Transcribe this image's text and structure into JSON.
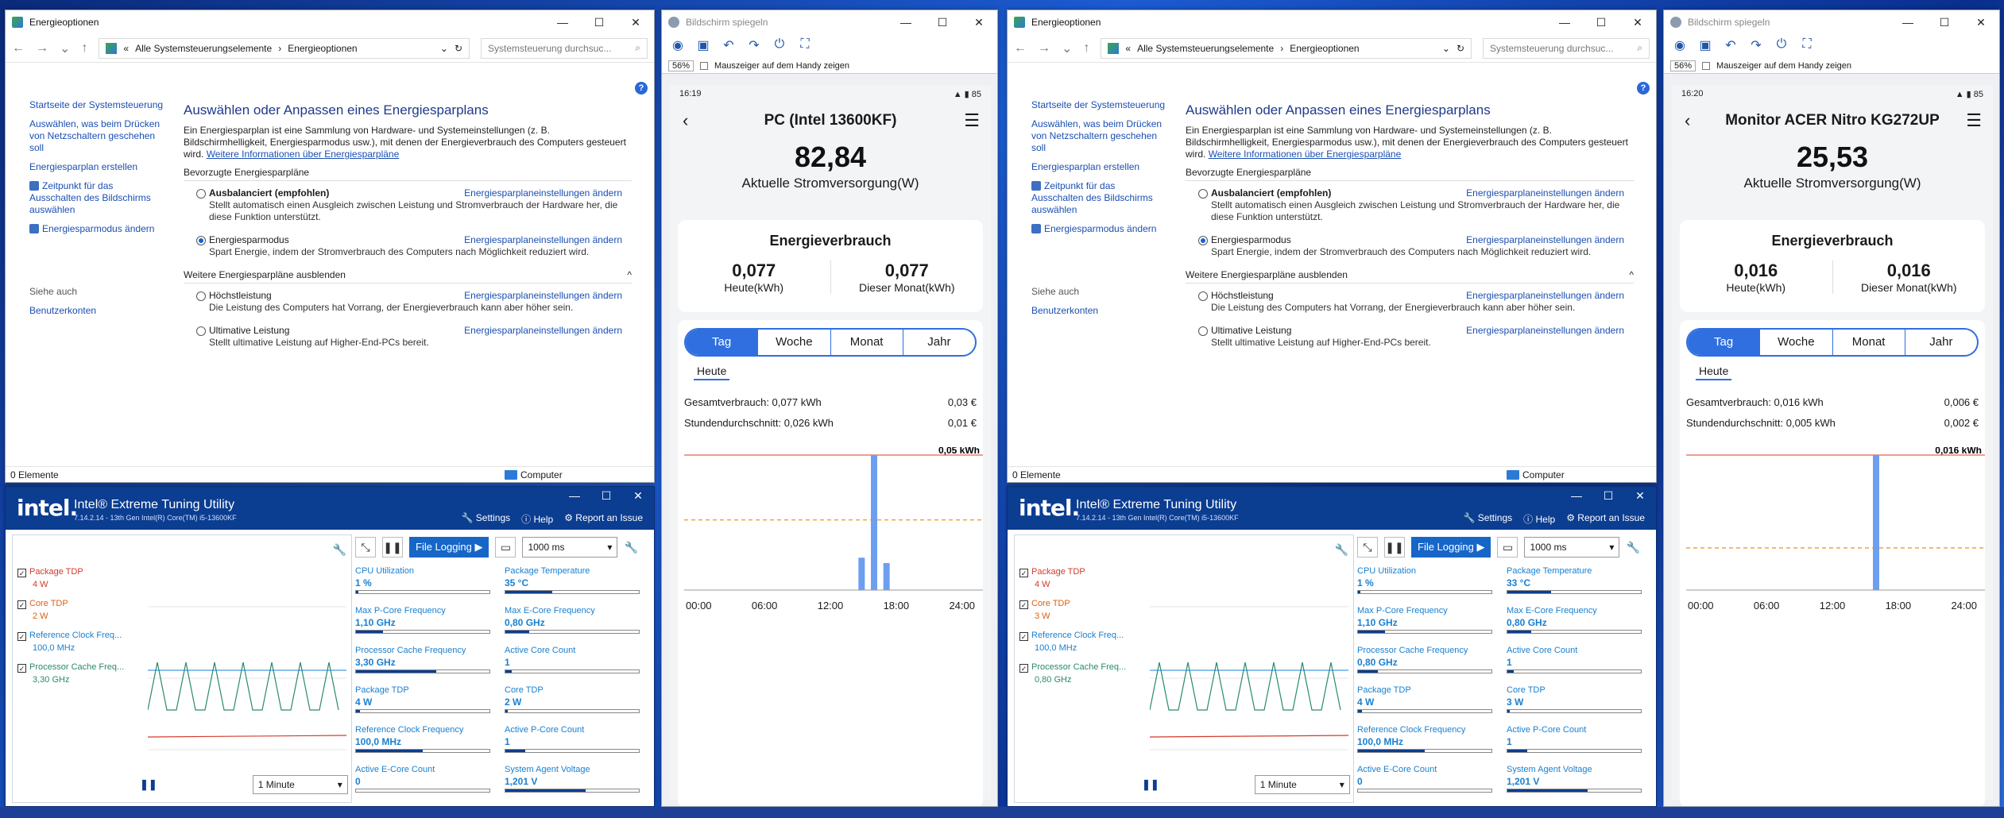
{
  "screens": [
    {
      "energy": {
        "title": "Energieoptionen",
        "breadcrumb_root": "Alle Systemsteuerungselemente",
        "breadcrumb_current": "Energieoptionen",
        "search_placeholder": "Systemsteuerung durchsuc...",
        "sidebar": [
          "Startseite der Systemsteuerung",
          "Auswählen, was beim Drücken von Netzschaltern geschehen soll",
          "Energiesparplan erstellen",
          "Zeitpunkt für das Ausschalten des Bildschirms auswählen",
          "Energiesparmodus ändern"
        ],
        "see_also": "Siehe auch",
        "see_also_link": "Benutzerkonten",
        "heading": "Auswählen oder Anpassen eines Energiesparplans",
        "intro": "Ein Energiesparplan ist eine Sammlung von Hardware- und Systemeinstellungen (z. B. Bildschirmhelligkeit, Energiesparmodus usw.), mit denen der Energieverbrauch des Computers gesteuert wird.",
        "intro_link": "Weitere Informationen über Energiesparpläne",
        "preferred": "Bevorzugte Energiesparpläne",
        "more": "Weitere Energiesparpläne ausblenden",
        "change": "Energiesparplaneinstellungen ändern",
        "plans_pref": [
          {
            "name": "Ausbalanciert (empfohlen)",
            "desc": "Stellt automatisch einen Ausgleich zwischen Leistung und Stromverbrauch der Hardware her, die diese Funktion unterstützt.",
            "selected": false
          },
          {
            "name": "Energiesparmodus",
            "desc": "Spart Energie, indem der Stromverbrauch des Computers nach Möglichkeit reduziert wird.",
            "selected": true
          }
        ],
        "plans_more": [
          {
            "name": "Höchstleistung",
            "desc": "Die Leistung des Computers hat Vorrang, der Energieverbrauch kann aber höher sein."
          },
          {
            "name": "Ultimative Leistung",
            "desc": "Stellt ultimative Leistung auf Higher-End-PCs bereit."
          }
        ],
        "status_left": "0 Elemente",
        "status_right": "Computer"
      },
      "xtu": {
        "title": "Intel® Extreme Tuning Utility",
        "version": "7.14.2.14 - 13th Gen Intel(R) Core(TM) i5-13600KF",
        "links": [
          "Settings",
          "Help",
          "Report an Issue"
        ],
        "monitors": [
          {
            "label": "Package TDP",
            "value": "4 W",
            "color": "#d23a2a"
          },
          {
            "label": "Core TDP",
            "value": "2 W",
            "color": "#e06010"
          },
          {
            "label": "Reference Clock Freq...",
            "value": "100,0 MHz",
            "color": "#1a80d0"
          },
          {
            "label": "Processor Cache Freq...",
            "value": "3,30 GHz",
            "color": "#2a8a6a"
          }
        ],
        "graph_range": "1 Minute",
        "file_logging": "File Logging ▶",
        "interval": "1000 ms",
        "metrics": [
          {
            "label": "CPU Utilization",
            "value": "1 %",
            "fill": 0.02
          },
          {
            "label": "Package Temperature",
            "value": "35 °C",
            "fill": 0.35
          },
          {
            "label": "Max P-Core Frequency",
            "value": "1,10 GHz",
            "fill": 0.2
          },
          {
            "label": "Max E-Core Frequency",
            "value": "0,80 GHz",
            "fill": 0.18
          },
          {
            "label": "Processor Cache Frequency",
            "value": "3,30 GHz",
            "fill": 0.6
          },
          {
            "label": "Active Core Count",
            "value": "1",
            "fill": 0.05
          },
          {
            "label": "Package TDP",
            "value": "4 W",
            "fill": 0.03
          },
          {
            "label": "Core TDP",
            "value": "2 W",
            "fill": 0.02
          },
          {
            "label": "Reference Clock Frequency",
            "value": "100,0 MHz",
            "fill": 0.5
          },
          {
            "label": "Active P-Core Count",
            "value": "1",
            "fill": 0.15
          },
          {
            "label": "Active E-Core Count",
            "value": "0",
            "fill": 0.0
          },
          {
            "label": "System Agent Voltage",
            "value": "1,201 V",
            "fill": 0.6
          }
        ]
      },
      "mirror": {
        "title": "Bildschirm spiegeln",
        "zoom": "56%",
        "mouse": "Mauszeiger auf dem Handy zeigen",
        "time": "16:19",
        "battery": "85",
        "device": "PC (Intel 13600KF)",
        "power": "82,84",
        "power_label": "Aktuelle Stromversorgung(W)",
        "consumption": "Energieverbrauch",
        "today_val": "0,077",
        "today_lbl": "Heute(kWh)",
        "month_val": "0,077",
        "month_lbl": "Dieser Monat(kWh)",
        "tabs": [
          "Tag",
          "Woche",
          "Monat",
          "Jahr"
        ],
        "subtab": "Heute",
        "total_label": "Gesamtverbrauch: 0,077 kWh",
        "total_cost": "0,03 €",
        "avg_label": "Stundendurchschnitt: 0,026 kWh",
        "avg_cost": "0,01 €",
        "max_label": "0,05 kWh",
        "xticks": [
          "00:00",
          "06:00",
          "12:00",
          "18:00",
          "24:00"
        ]
      },
      "chart_data": {
        "type": "bar",
        "x": [
          "14:00",
          "15:00",
          "16:00"
        ],
        "values": [
          0.012,
          0.05,
          0.01
        ],
        "ylim": [
          0,
          0.05
        ],
        "average": 0.026,
        "xticks": [
          "00:00",
          "06:00",
          "12:00",
          "18:00",
          "24:00"
        ]
      }
    },
    {
      "energy": {
        "title": "Energieoptionen",
        "breadcrumb_root": "Alle Systemsteuerungselemente",
        "breadcrumb_current": "Energieoptionen",
        "search_placeholder": "Systemsteuerung durchsuc...",
        "sidebar": [
          "Startseite der Systemsteuerung",
          "Auswählen, was beim Drücken von Netzschaltern geschehen soll",
          "Energiesparplan erstellen",
          "Zeitpunkt für das Ausschalten des Bildschirms auswählen",
          "Energiesparmodus ändern"
        ],
        "see_also": "Siehe auch",
        "see_also_link": "Benutzerkonten",
        "heading": "Auswählen oder Anpassen eines Energiesparplans",
        "intro": "Ein Energiesparplan ist eine Sammlung von Hardware- und Systemeinstellungen (z. B. Bildschirmhelligkeit, Energiesparmodus usw.), mit denen der Energieverbrauch des Computers gesteuert wird.",
        "intro_link": "Weitere Informationen über Energiesparpläne",
        "preferred": "Bevorzugte Energiesparpläne",
        "more": "Weitere Energiesparpläne ausblenden",
        "change": "Energiesparplaneinstellungen ändern",
        "plans_pref": [
          {
            "name": "Ausbalanciert (empfohlen)",
            "desc": "Stellt automatisch einen Ausgleich zwischen Leistung und Stromverbrauch der Hardware her, die diese Funktion unterstützt.",
            "selected": false
          },
          {
            "name": "Energiesparmodus",
            "desc": "Spart Energie, indem der Stromverbrauch des Computers nach Möglichkeit reduziert wird.",
            "selected": true
          }
        ],
        "plans_more": [
          {
            "name": "Höchstleistung",
            "desc": "Die Leistung des Computers hat Vorrang, der Energieverbrauch kann aber höher sein."
          },
          {
            "name": "Ultimative Leistung",
            "desc": "Stellt ultimative Leistung auf Higher-End-PCs bereit."
          }
        ],
        "status_left": "0 Elemente",
        "status_right": "Computer"
      },
      "xtu": {
        "title": "Intel® Extreme Tuning Utility",
        "version": "7.14.2.14 - 13th Gen Intel(R) Core(TM) i5-13600KF",
        "links": [
          "Settings",
          "Help",
          "Report an Issue"
        ],
        "monitors": [
          {
            "label": "Package TDP",
            "value": "4 W",
            "color": "#d23a2a"
          },
          {
            "label": "Core TDP",
            "value": "3 W",
            "color": "#e06010"
          },
          {
            "label": "Reference Clock Freq...",
            "value": "100,0 MHz",
            "color": "#1a80d0"
          },
          {
            "label": "Processor Cache Freq...",
            "value": "0,80 GHz",
            "color": "#2a8a6a"
          }
        ],
        "graph_range": "1 Minute",
        "file_logging": "File Logging ▶",
        "interval": "1000 ms",
        "metrics": [
          {
            "label": "CPU Utilization",
            "value": "1 %",
            "fill": 0.02
          },
          {
            "label": "Package Temperature",
            "value": "33 °C",
            "fill": 0.33
          },
          {
            "label": "Max P-Core Frequency",
            "value": "1,10 GHz",
            "fill": 0.2
          },
          {
            "label": "Max E-Core Frequency",
            "value": "0,80 GHz",
            "fill": 0.18
          },
          {
            "label": "Processor Cache Frequency",
            "value": "0,80 GHz",
            "fill": 0.15
          },
          {
            "label": "Active Core Count",
            "value": "1",
            "fill": 0.05
          },
          {
            "label": "Package TDP",
            "value": "4 W",
            "fill": 0.03
          },
          {
            "label": "Core TDP",
            "value": "3 W",
            "fill": 0.02
          },
          {
            "label": "Reference Clock Frequency",
            "value": "100,0 MHz",
            "fill": 0.5
          },
          {
            "label": "Active P-Core Count",
            "value": "1",
            "fill": 0.15
          },
          {
            "label": "Active E-Core Count",
            "value": "0",
            "fill": 0.0
          },
          {
            "label": "System Agent Voltage",
            "value": "1,201 V",
            "fill": 0.6
          }
        ]
      },
      "mirror": {
        "title": "Bildschirm spiegeln",
        "zoom": "56%",
        "mouse": "Mauszeiger auf dem Handy zeigen",
        "time": "16:20",
        "battery": "85",
        "device": "Monitor ACER Nitro KG272UP",
        "power": "25,53",
        "power_label": "Aktuelle Stromversorgung(W)",
        "consumption": "Energieverbrauch",
        "today_val": "0,016",
        "today_lbl": "Heute(kWh)",
        "month_val": "0,016",
        "month_lbl": "Dieser Monat(kWh)",
        "tabs": [
          "Tag",
          "Woche",
          "Monat",
          "Jahr"
        ],
        "subtab": "Heute",
        "total_label": "Gesamtverbrauch: 0,016 kWh",
        "total_cost": "0,006 €",
        "avg_label": "Stundendurchschnitt: 0,005 kWh",
        "avg_cost": "0,002 €",
        "max_label": "0,016 kWh",
        "xticks": [
          "00:00",
          "06:00",
          "12:00",
          "18:00",
          "24:00"
        ]
      },
      "chart_data": {
        "type": "bar",
        "x": [
          "15:00"
        ],
        "values": [
          0.016
        ],
        "ylim": [
          0,
          0.016
        ],
        "average": 0.005,
        "xticks": [
          "00:00",
          "06:00",
          "12:00",
          "18:00",
          "24:00"
        ]
      }
    }
  ]
}
